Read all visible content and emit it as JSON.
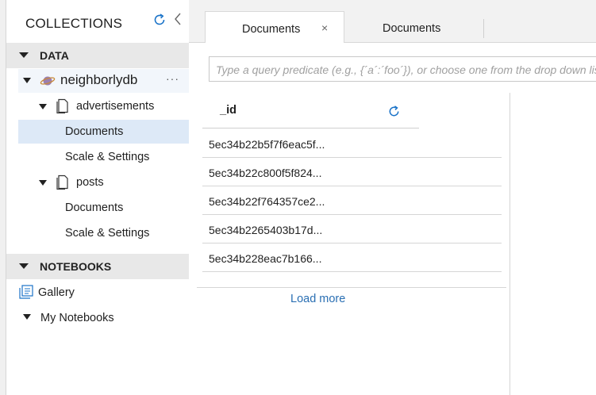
{
  "sidebar": {
    "title": "COLLECTIONS",
    "sections": {
      "data": "DATA",
      "notebooks": "NOTEBOOKS"
    },
    "database": {
      "name": "neighborlydb",
      "more": "···"
    },
    "collections": [
      {
        "name": "advertisements",
        "items": [
          "Documents",
          "Scale & Settings"
        ]
      },
      {
        "name": "posts",
        "items": [
          "Documents",
          "Scale & Settings"
        ]
      }
    ],
    "notebook_items": {
      "gallery": "Gallery",
      "my_notebooks": "My Notebooks"
    }
  },
  "tabs": [
    {
      "label": "Documents",
      "close": "×",
      "active": true
    },
    {
      "label": "Documents",
      "active": false
    }
  ],
  "query": {
    "placeholder": "Type a query predicate (e.g., {´a´:´foo´}), or choose one from the drop down list, or leave empty to query all documents."
  },
  "documents": {
    "header": "_id",
    "ids": [
      "5ec34b22b5f7f6eac5f...",
      "5ec34b22c800f5f824...",
      "5ec34b22f764357ce2...",
      "5ec34b2265403b17d...",
      "5ec34b228eac7b166..."
    ],
    "load_more": "Load more"
  },
  "icons": {
    "refresh": "refresh-icon",
    "collapse": "chevron-left-icon",
    "database": "planet-icon",
    "collection": "document-icon",
    "gallery": "gallery-icon",
    "accent_color": "#1a73c8"
  }
}
